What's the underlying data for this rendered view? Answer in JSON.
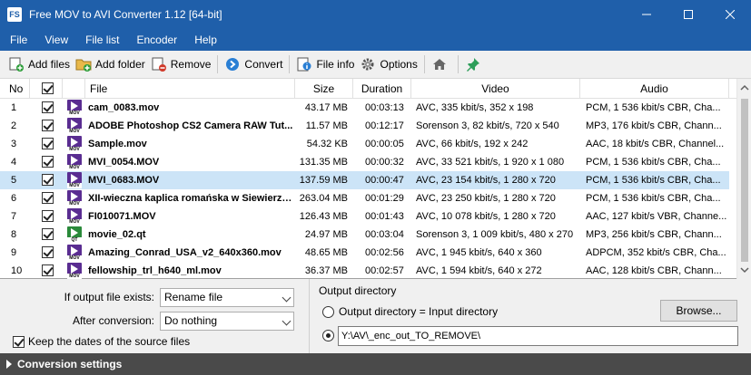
{
  "window": {
    "title": "Free MOV to AVI Converter 1.12  [64-bit]",
    "icon_text": "FS"
  },
  "menu": [
    "File",
    "View",
    "File list",
    "Encoder",
    "Help"
  ],
  "toolbar": {
    "add_files": "Add files",
    "add_folder": "Add folder",
    "remove": "Remove",
    "convert": "Convert",
    "file_info": "File info",
    "options": "Options"
  },
  "table": {
    "headers": {
      "no": "No",
      "file": "File",
      "size": "Size",
      "duration": "Duration",
      "video": "Video",
      "audio": "Audio"
    },
    "selected_row": 4,
    "rows": [
      {
        "no": "1",
        "file": "cam_0083.mov",
        "ext": "MOV",
        "size": "43.17 MB",
        "duration": "00:03:13",
        "video": "AVC, 335 kbit/s, 352 x 198",
        "audio": "PCM, 1 536 kbit/s CBR, Cha..."
      },
      {
        "no": "2",
        "file": "ADOBE Photoshop CS2 Camera RAW Tut...",
        "ext": "MOV",
        "size": "11.57 MB",
        "duration": "00:12:17",
        "video": "Sorenson 3, 82 kbit/s, 720 x 540",
        "audio": "MP3, 176 kbit/s CBR, Chann..."
      },
      {
        "no": "3",
        "file": "Sample.mov",
        "ext": "MOV",
        "size": "54.32 KB",
        "duration": "00:00:05",
        "video": "AVC, 66 kbit/s, 192 x 242",
        "audio": "AAC, 18 kbit/s CBR, Channel..."
      },
      {
        "no": "4",
        "file": "MVI_0054.MOV",
        "ext": "MOV",
        "size": "131.35 MB",
        "duration": "00:00:32",
        "video": "AVC, 33 521 kbit/s, 1 920 x 1 080",
        "audio": "PCM, 1 536 kbit/s CBR, Cha..."
      },
      {
        "no": "5",
        "file": "MVI_0683.MOV",
        "ext": "MOV",
        "size": "137.59 MB",
        "duration": "00:00:47",
        "video": "AVC, 23 154 kbit/s, 1 280 x 720",
        "audio": "PCM, 1 536 kbit/s CBR, Cha..."
      },
      {
        "no": "6",
        "file": "XII-wieczna kaplica romańska w Siewierzu...",
        "ext": "MOV",
        "size": "263.04 MB",
        "duration": "00:01:29",
        "video": "AVC, 23 250 kbit/s, 1 280 x 720",
        "audio": "PCM, 1 536 kbit/s CBR, Cha..."
      },
      {
        "no": "7",
        "file": "FI010071.MOV",
        "ext": "MOV",
        "size": "126.43 MB",
        "duration": "00:01:43",
        "video": "AVC, 10 078 kbit/s, 1 280 x 720",
        "audio": "AAC, 127 kbit/s VBR, Channe..."
      },
      {
        "no": "8",
        "file": "movie_02.qt",
        "ext": "QT",
        "size": "24.97 MB",
        "duration": "00:03:04",
        "video": "Sorenson 3, 1 009 kbit/s, 480 x 270",
        "audio": "MP3, 256 kbit/s CBR, Chann..."
      },
      {
        "no": "9",
        "file": "Amazing_Conrad_USA_v2_640x360.mov",
        "ext": "MOV",
        "size": "48.65 MB",
        "duration": "00:02:56",
        "video": "AVC, 1 945 kbit/s, 640 x 360",
        "audio": "ADPCM, 352 kbit/s CBR, Cha..."
      },
      {
        "no": "10",
        "file": "fellowship_trl_h640_ml.mov",
        "ext": "MOV",
        "size": "36.37 MB",
        "duration": "00:02:57",
        "video": "AVC, 1 594 kbit/s, 640 x 272",
        "audio": "AAC, 128 kbit/s CBR, Chann..."
      }
    ]
  },
  "options": {
    "if_exists_label": "If output file exists:",
    "if_exists_value": "Rename file",
    "after_conversion_label": "After conversion:",
    "after_conversion_value": "Do nothing",
    "keep_dates_label": "Keep the dates of the source files"
  },
  "output": {
    "section_label": "Output directory",
    "radio_input_label": "Output directory = Input directory",
    "browse_label": "Browse...",
    "path_value": "Y:\\AV\\_enc_out_TO_REMOVE\\"
  },
  "settings_bar": {
    "label": "Conversion settings"
  },
  "colors": {
    "titlebar": "#1f5faa",
    "selected_row": "#cce4f7",
    "settings_bar": "#4a4a4a"
  }
}
